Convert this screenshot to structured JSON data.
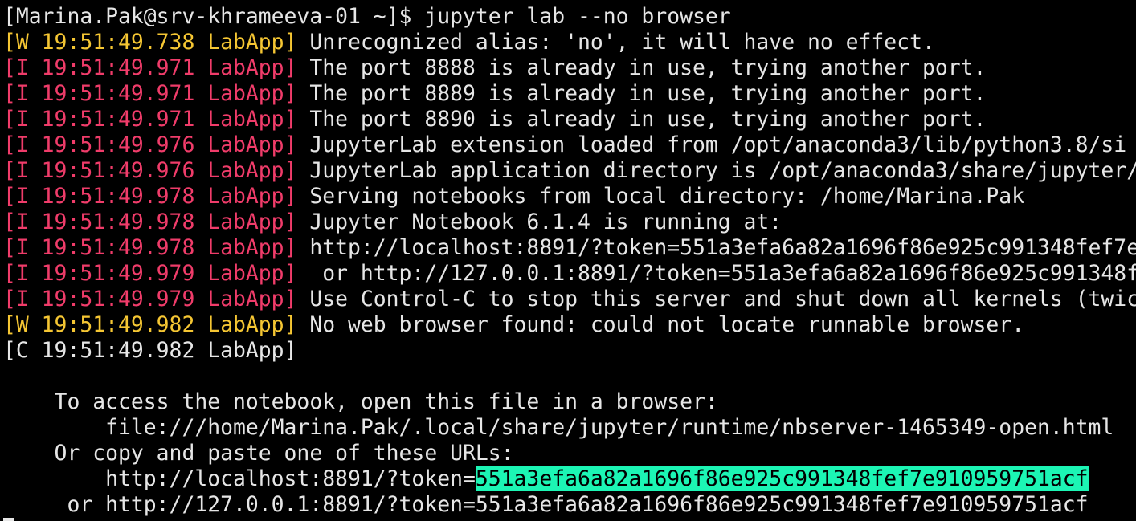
{
  "colors": {
    "background": "#000000",
    "text": "#e6e6e6",
    "warning_tag": "#f5c633",
    "info_tag": "#f03c6a",
    "token_highlight": "#1cf5b4"
  },
  "prompt": {
    "text": "[Marina.Pak@srv-khrameeva-01 ~]$ jupyter lab --no browser"
  },
  "log": [
    {
      "level": "W",
      "tag": "[W 19:51:49.738 LabApp]",
      "msg": " Unrecognized alias: 'no', it will have no effect."
    },
    {
      "level": "I",
      "tag": "[I 19:51:49.971 LabApp]",
      "msg": " The port 8888 is already in use, trying another port."
    },
    {
      "level": "I",
      "tag": "[I 19:51:49.971 LabApp]",
      "msg": " The port 8889 is already in use, trying another port."
    },
    {
      "level": "I",
      "tag": "[I 19:51:49.971 LabApp]",
      "msg": " The port 8890 is already in use, trying another port."
    },
    {
      "level": "I",
      "tag": "[I 19:51:49.976 LabApp]",
      "msg": " JupyterLab extension loaded from /opt/anaconda3/lib/python3.8/si"
    },
    {
      "level": "I",
      "tag": "[I 19:51:49.976 LabApp]",
      "msg": " JupyterLab application directory is /opt/anaconda3/share/jupyter/"
    },
    {
      "level": "I",
      "tag": "[I 19:51:49.978 LabApp]",
      "msg": " Serving notebooks from local directory: /home/Marina.Pak"
    },
    {
      "level": "I",
      "tag": "[I 19:51:49.978 LabApp]",
      "msg": " Jupyter Notebook 6.1.4 is running at:"
    },
    {
      "level": "I",
      "tag": "[I 19:51:49.978 LabApp]",
      "msg": " http://localhost:8891/?token=551a3efa6a82a1696f86e925c991348fef7e"
    },
    {
      "level": "I",
      "tag": "[I 19:51:49.979 LabApp]",
      "msg": "  or http://127.0.0.1:8891/?token=551a3efa6a82a1696f86e925c991348f"
    },
    {
      "level": "I",
      "tag": "[I 19:51:49.979 LabApp]",
      "msg": " Use Control-C to stop this server and shut down all kernels (twic"
    },
    {
      "level": "W",
      "tag": "[W 19:51:49.982 LabApp]",
      "msg": " No web browser found: could not locate runnable browser."
    },
    {
      "level": "C",
      "tag": "[C 19:51:49.982 LabApp]",
      "msg": ""
    }
  ],
  "access": {
    "intro": "    To access the notebook, open this file in a browser:",
    "file_url": "        file:///home/Marina.Pak/.local/share/jupyter/runtime/nbserver-1465349-open.html",
    "copy_text": "    Or copy and paste one of these URLs:",
    "url1_prefix": "        http://localhost:8891/?token=",
    "url1_token": "551a3efa6a82a1696f86e925c991348fef7e910959751acf",
    "url2": "     or http://127.0.0.1:8891/?token=551a3efa6a82a1696f86e925c991348fef7e910959751acf"
  }
}
